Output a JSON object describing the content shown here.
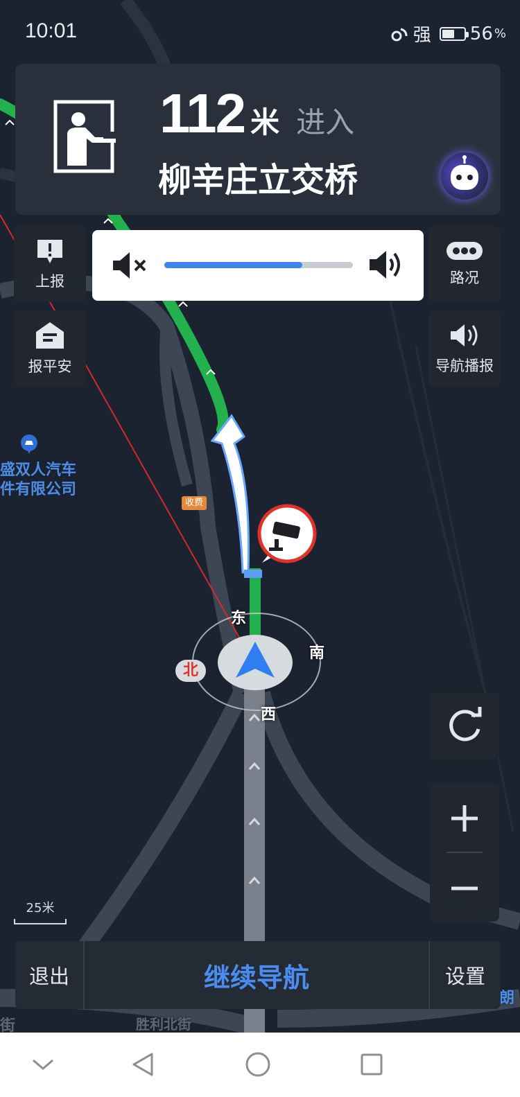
{
  "status_bar": {
    "time": "10:01",
    "signal_text": "强",
    "battery_percent": "56",
    "battery_unit": "%",
    "battery_level": 0.56
  },
  "guidance": {
    "distance_value": "112",
    "distance_unit": "米",
    "action": "进入",
    "road_name": "柳辛庄立交桥",
    "turn_icon": "enter-bridge-icon"
  },
  "side_buttons": {
    "report": "上报",
    "safe_report": "报平安",
    "traffic": "路况",
    "voice_broadcast": "导航播报"
  },
  "volume": {
    "level": 0.73,
    "accent_color": "#3c84ee"
  },
  "map": {
    "poi_line1": "盛双人汽车",
    "poi_line2": "件有限公司",
    "toll": "收费",
    "compass": {
      "east": "东",
      "south": "南",
      "west": "西",
      "north": "北"
    },
    "scale": "25米",
    "route_color": "#22b14c",
    "edge_text_1": "朗",
    "edge_text_2": "街",
    "edge_text_3": "胜利北街"
  },
  "bottom_bar": {
    "exit": "退出",
    "continue": "继续导航",
    "settings": "设置"
  },
  "system_nav": {
    "back_icon": "back-triangle-icon",
    "home_icon": "home-circle-icon",
    "recent_icon": "recent-square-icon",
    "collapse_icon": "chevron-down-icon"
  }
}
